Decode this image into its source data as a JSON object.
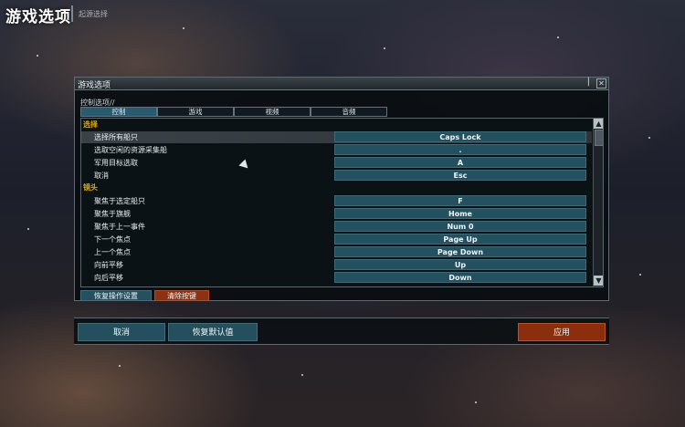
{
  "header": {
    "title": "游戏选项",
    "subtitle": "起源选择"
  },
  "dialog": {
    "title": "游戏选项",
    "title_suffix": "|",
    "section_label": "控制选项//",
    "tabs": [
      {
        "label": "控制",
        "active": true
      },
      {
        "label": "游戏",
        "active": false
      },
      {
        "label": "视频",
        "active": false
      },
      {
        "label": "音频",
        "active": false
      }
    ],
    "groups": [
      {
        "name": "选择",
        "bindings": [
          {
            "action": "选择所有船只",
            "key": "Caps Lock",
            "selected": true
          },
          {
            "action": "选取空闲的资源采集船",
            "key": "."
          },
          {
            "action": "军用目标选取",
            "key": "A"
          },
          {
            "action": "取消",
            "key": "Esc"
          }
        ]
      },
      {
        "name": "镜头",
        "bindings": [
          {
            "action": "聚焦于选定船只",
            "key": "F"
          },
          {
            "action": "聚焦于旗舰",
            "key": "Home"
          },
          {
            "action": "聚焦于上一事件",
            "key": "Num 0"
          },
          {
            "action": "下一个焦点",
            "key": "Page Up"
          },
          {
            "action": "上一个焦点",
            "key": "Page Down"
          },
          {
            "action": "向前平移",
            "key": "Up"
          },
          {
            "action": "向后平移",
            "key": "Down"
          }
        ]
      }
    ],
    "restore_controls_label": "恢复操作设置",
    "clear_binding_label": "清除按键"
  },
  "footer": {
    "cancel_label": "取消",
    "restore_defaults_label": "恢复默认值",
    "apply_label": "应用"
  },
  "colors": {
    "group_header": "#e0a900",
    "key_field": "#24515f",
    "accent_orange": "#8b2e0e"
  },
  "icons": {
    "scroll_up": "triangle-up",
    "scroll_down": "triangle-down",
    "close": "close-icon",
    "cursor": "arrow-cursor"
  }
}
